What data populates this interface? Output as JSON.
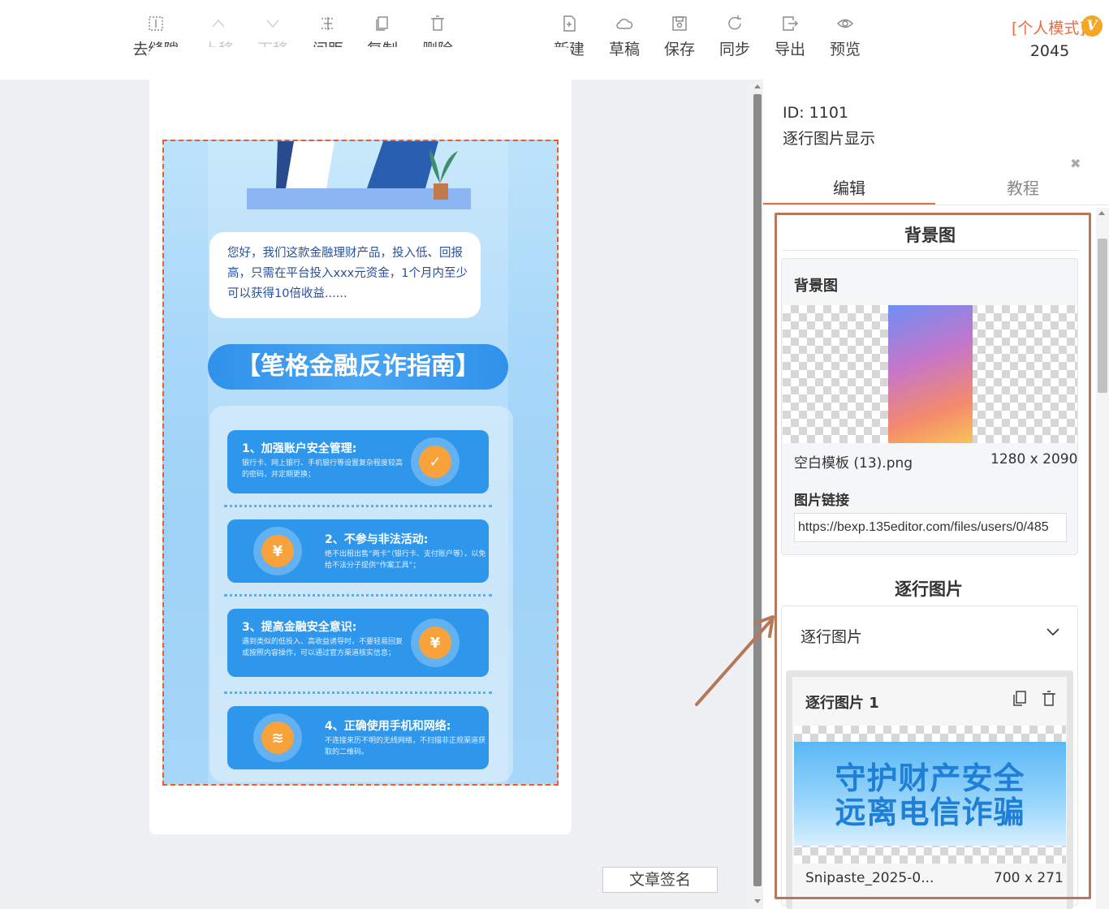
{
  "toolbar": {
    "buttons": [
      {
        "label": "去缝隙",
        "icon": "gap-icon",
        "disabled": false
      },
      {
        "label": "上移",
        "icon": "chevron-up-icon",
        "disabled": true
      },
      {
        "label": "下移",
        "icon": "chevron-down-icon",
        "disabled": true
      },
      {
        "label": "间距",
        "icon": "spacing-icon",
        "disabled": false
      },
      {
        "label": "复制",
        "icon": "copy-icon",
        "disabled": false
      },
      {
        "label": "删除",
        "icon": "trash-icon",
        "disabled": false
      },
      {
        "label": "新建",
        "icon": "new-file-icon",
        "disabled": false
      },
      {
        "label": "草稿",
        "icon": "cloud-icon",
        "disabled": false
      },
      {
        "label": "保存",
        "icon": "save-icon",
        "disabled": false
      },
      {
        "label": "同步",
        "icon": "sync-icon",
        "disabled": false
      },
      {
        "label": "导出",
        "icon": "export-icon",
        "disabled": false
      },
      {
        "label": "预览",
        "icon": "eye-icon",
        "disabled": false
      }
    ],
    "mode": "[个人模式]",
    "badge": "V",
    "count": "2045"
  },
  "canvas": {
    "signature_button": "文章签名",
    "poster": {
      "bubble_text": "您好，我们这款金融理财产品，投入低、回报高，只需在平台投入xxx元资金，1个月内至少可以获得10倍收益......",
      "title": "【笔格金融反诈指南】",
      "tips": [
        {
          "title": "1、加强账户安全管理:",
          "desc": "银行卡、网上银行、手机银行等设置复杂程度较高的密码，并定期更换；"
        },
        {
          "title": "2、不参与非法活动:",
          "desc": "绝不出租出售“两卡”（银行卡、支付账户等），以免给不法分子提供“作案工具”；"
        },
        {
          "title": "3、提高金融安全意识:",
          "desc": "遇到类似的低投入、高收益诱导时，不要轻易回复或按照内容操作，可以通过官方渠道核实信息；"
        },
        {
          "title": "4、正确使用手机和网络:",
          "desc": "不连接来历不明的无线网络，不扫描非正规渠道获取的二维码。"
        }
      ]
    }
  },
  "panel": {
    "id_text": "ID: 1101",
    "name": "逐行图片显示",
    "tabs": [
      "编辑",
      "教程"
    ],
    "bg_section": {
      "title": "背景图",
      "card_title": "背景图",
      "file_name": "空白模板 (13).png",
      "file_size": "1280 x 2090",
      "link_label": "图片链接",
      "link_value": "https://bexp.135editor.com/files/users/0/485"
    },
    "rows_section": {
      "title": "逐行图片",
      "dropdown_label": "逐行图片",
      "item_title": "逐行图片 1",
      "preview_line1": "守护财产安全",
      "preview_line2": "远离电信诈骗",
      "file_name": "Snipaste_2025-0...",
      "file_size": "700 x 271"
    }
  },
  "colors": {
    "accent": "#f06a3c",
    "annotation": "#b5785a",
    "poster_blue": "#2e97ec"
  }
}
